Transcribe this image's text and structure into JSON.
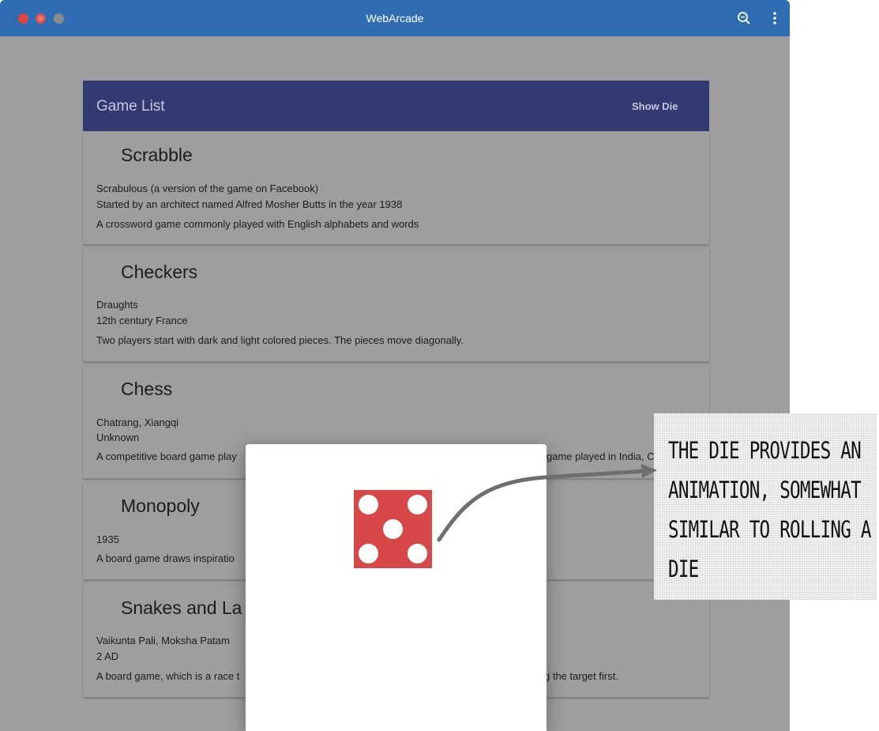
{
  "window": {
    "title": "WebArcade"
  },
  "toolbar": {
    "icons": [
      "search-icon",
      "more-vert-icon"
    ]
  },
  "game_list": {
    "title": "Game List",
    "action_label": "Show Die",
    "items": [
      {
        "name": "Scrabble",
        "lines": [
          "Scrabulous (a version of the game on Facebook)",
          "Started by an architect named Alfred Mosher Butts in the year 1938",
          "A crossword game commonly played with English alphabets and words"
        ]
      },
      {
        "name": "Checkers",
        "lines": [
          "Draughts",
          "12th century France",
          "Two players start with dark and light colored pieces. The pieces move diagonally."
        ]
      },
      {
        "name": "Chess",
        "lines": [
          "Chatrang, Xiangqi",
          "Unknown",
          "A competitive board game play",
          "game played in India, C"
        ]
      },
      {
        "name": "Monopoly",
        "lines": [
          "1935",
          "A board game draws inspiratio"
        ]
      },
      {
        "name": "Snakes and La",
        "lines": [
          "Vaikunta Pali, Moksha Patam",
          "2 AD",
          "A board game, which is a race t",
          "g the target first."
        ]
      }
    ]
  },
  "die": {
    "value": 5,
    "color": "#d94848"
  },
  "annotation": {
    "text": "The die provides an animation, somewhat similar to rolling a die"
  },
  "colors": {
    "titlebar": "#2f6db3",
    "list_header": "#333a72",
    "overlay": "#9e9e9e"
  }
}
